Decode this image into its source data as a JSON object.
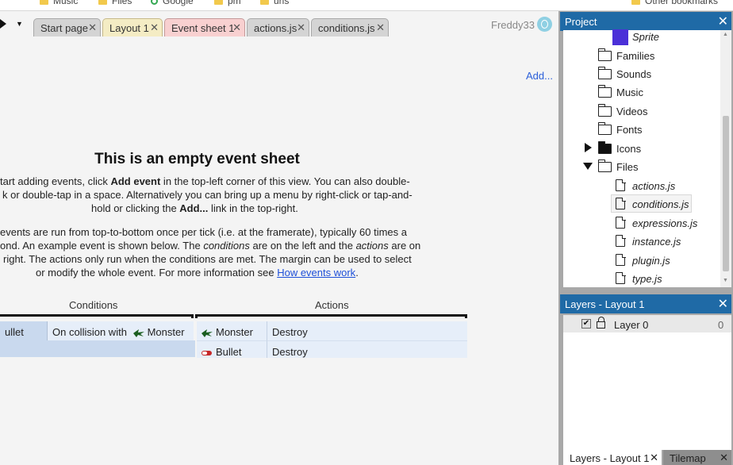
{
  "bookmarks": {
    "items": [
      "Music",
      "Files",
      "Google",
      "pm",
      "urls",
      "Other bookmarks"
    ]
  },
  "tabs": {
    "items": [
      "Start page",
      "Layout 1",
      "Event sheet 1",
      "actions.js",
      "conditions.js"
    ],
    "close": "✕"
  },
  "user": {
    "name": "Freddy33"
  },
  "eventsheet": {
    "add_link": "Add...",
    "title": "This is an empty event sheet",
    "p1": {
      "l1_a": "tart adding events, click ",
      "l1_b": "Add event",
      "l1_c": " in the top-left corner of this view. You can also double-",
      "l2": "k or double-tap in a space. Alternatively you can bring up a menu by right-click or tap-and-",
      "l3_a": "hold or clicking the ",
      "l3_b": "Add...",
      "l3_c": " link in the top-right."
    },
    "p2": {
      "l1": "events are run from top-to-bottom once per tick (i.e. at the framerate), typically 60 times a",
      "l2_a": "ond. An example event is shown below. The ",
      "l2_b": "conditions",
      "l2_c": " are on the left and the ",
      "l2_d": "actions",
      "l2_e": " are on",
      "l3": " right. The actions only run when the conditions are met. The margin can be used to select",
      "l4_a": "or modify the whole event. For more information see ",
      "l4_link": "How events work",
      "l4_b": "."
    },
    "conditions_header": "Conditions",
    "actions_header": "Actions",
    "condition": {
      "object": "ullet",
      "text": "On collision with",
      "target": "Monster"
    },
    "actions": [
      {
        "object": "Monster",
        "action": "Destroy"
      },
      {
        "object": "Bullet",
        "action": "Destroy"
      }
    ]
  },
  "project": {
    "title": "Project",
    "close": "✕",
    "items": [
      "Sprite",
      "Families",
      "Sounds",
      "Music",
      "Videos",
      "Fonts",
      "Icons",
      "Files",
      "actions.js",
      "conditions.js",
      "expressions.js",
      "instance.js",
      "plugin.js",
      "type.js"
    ]
  },
  "layers": {
    "title": "Layers - Layout 1",
    "close": "✕",
    "layer_name": "Layer 0",
    "layer_index": "0",
    "checkmark": "✔"
  },
  "bottom_tabs": {
    "items": [
      "Layers - Layout 1",
      "Tilemap"
    ],
    "close": "✕"
  },
  "colors": {
    "accent": "#1f6aa6",
    "active_tab": "#f8d0d0",
    "layout_tab": "#f4ecc4",
    "link": "#2b5fd9",
    "sprite": "#4b30d8"
  }
}
